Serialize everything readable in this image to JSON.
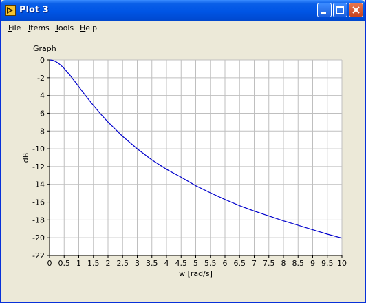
{
  "window": {
    "title": "Plot 3",
    "title_icon": "labview-icon",
    "controls": [
      "minimize-icon",
      "maximize-icon",
      "close-icon"
    ]
  },
  "menu": [
    {
      "label": "File",
      "mnemonic": "F",
      "rest": "ile"
    },
    {
      "label": "Items",
      "mnemonic": "I",
      "rest": "tems"
    },
    {
      "label": "Tools",
      "mnemonic": "T",
      "rest": "ools"
    },
    {
      "label": "Help",
      "mnemonic": "H",
      "rest": "elp"
    }
  ],
  "graph": {
    "label": "Graph"
  },
  "chart_data": {
    "type": "line",
    "xlabel": "w [rad/s]",
    "ylabel": "dB",
    "xlim": [
      0,
      10
    ],
    "ylim": [
      -22,
      0
    ],
    "grid": true,
    "x_ticks": [
      "0",
      "0.5",
      "1",
      "1.5",
      "2",
      "2.5",
      "3",
      "3.5",
      "4",
      "4.5",
      "5",
      "5.5",
      "6",
      "6.5",
      "7",
      "7.5",
      "8",
      "8.5",
      "9",
      "9.5",
      "10"
    ],
    "y_ticks": [
      "0",
      "-2",
      "-4",
      "-6",
      "-8",
      "-10",
      "-12",
      "-14",
      "-16",
      "-18",
      "-20",
      "-22"
    ],
    "series": [
      {
        "color": "#0000CC",
        "x": [
          0,
          0.1,
          0.2,
          0.3,
          0.4,
          0.5,
          0.6,
          0.7,
          0.8,
          0.9,
          1.0,
          1.25,
          1.5,
          1.75,
          2.0,
          2.5,
          3.0,
          3.5,
          4.0,
          4.5,
          5.0,
          5.5,
          6.0,
          6.5,
          7.0,
          7.5,
          8.0,
          8.5,
          9.0,
          9.5,
          10.0
        ],
        "y": [
          0,
          -0.04,
          -0.17,
          -0.37,
          -0.64,
          -0.97,
          -1.34,
          -1.73,
          -2.15,
          -2.58,
          -3.01,
          -4.09,
          -5.12,
          -6.09,
          -6.99,
          -8.6,
          -10.0,
          -11.25,
          -12.3,
          -13.2,
          -14.15,
          -14.95,
          -15.7,
          -16.4,
          -17.0,
          -17.55,
          -18.1,
          -18.6,
          -19.1,
          -19.6,
          -20.04
        ]
      }
    ],
    "plot_background": "#FFFFFF",
    "grid_color": "#BFBFBF"
  }
}
